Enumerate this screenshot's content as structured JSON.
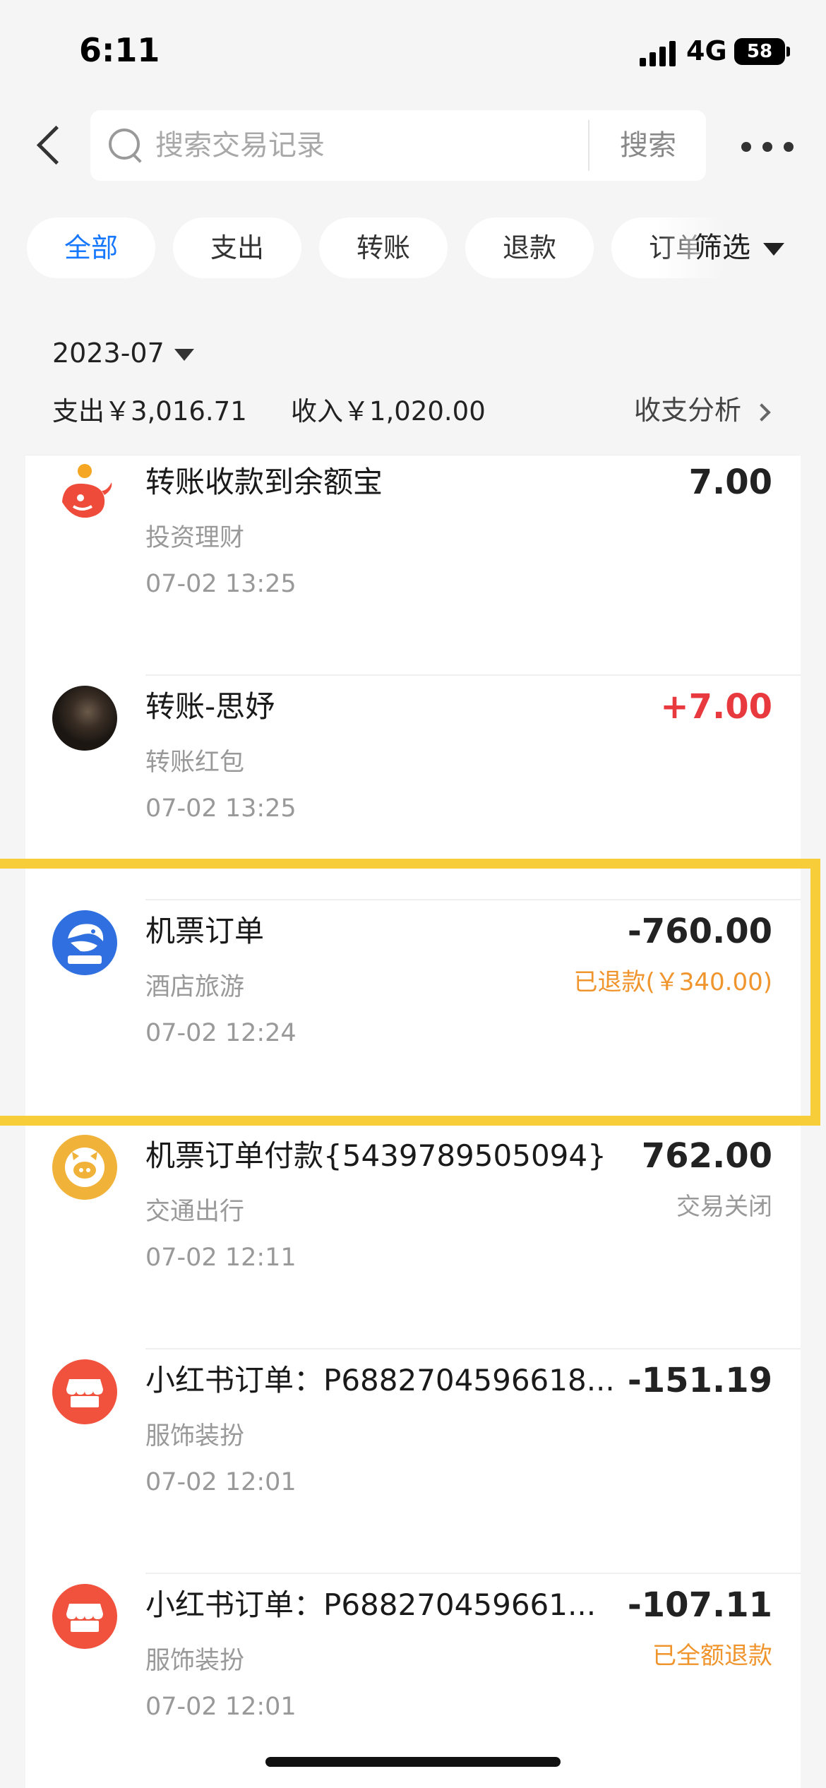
{
  "status_bar": {
    "time": "6:11",
    "network": "4G",
    "battery": "58"
  },
  "search": {
    "placeholder": "搜索交易记录",
    "button_label": "搜索"
  },
  "filters": {
    "chips": [
      "全部",
      "支出",
      "转账",
      "退款",
      "订单"
    ],
    "active_index": 0,
    "filter_label": "筛选"
  },
  "month": {
    "label": "2023-07",
    "expense": "支出￥3,016.71",
    "income": "收入￥1,020.00",
    "analysis_label": "收支分析"
  },
  "transactions": [
    {
      "title": "转账收款到余额宝",
      "category": "投资理财",
      "time": "07-02 13:25",
      "amount": "7.00",
      "status": "",
      "icon": "yuebao-icon"
    },
    {
      "title": "转账-思妤",
      "category": "转账红包",
      "time": "07-02 13:25",
      "amount": "+7.00",
      "status": "",
      "icon": "user-avatar"
    },
    {
      "title": "机票订单",
      "category": "酒店旅游",
      "time": "07-02 12:24",
      "amount": "-760.00",
      "status": "已退款(￥340.00)",
      "icon": "ctrip-icon",
      "highlighted": true
    },
    {
      "title": "机票订单付款{5439789505094}",
      "category": "交通出行",
      "time": "07-02 12:11",
      "amount": "762.00",
      "status": "交易关闭",
      "icon": "piggy-icon"
    },
    {
      "title": "小红书订单：P6882704596618...",
      "category": "服饰装扮",
      "time": "07-02 12:01",
      "amount": "-151.19",
      "status": "",
      "icon": "shop-icon"
    },
    {
      "title": "小红书订单：P688270459661...",
      "category": "服饰装扮",
      "time": "07-02 12:01",
      "amount": "-107.11",
      "status": "已全额退款",
      "icon": "shop-icon"
    }
  ],
  "colors": {
    "accent": "#1677ff",
    "income": "#e8393e",
    "refund": "#f0952d",
    "highlight": "#f8cd3a"
  }
}
